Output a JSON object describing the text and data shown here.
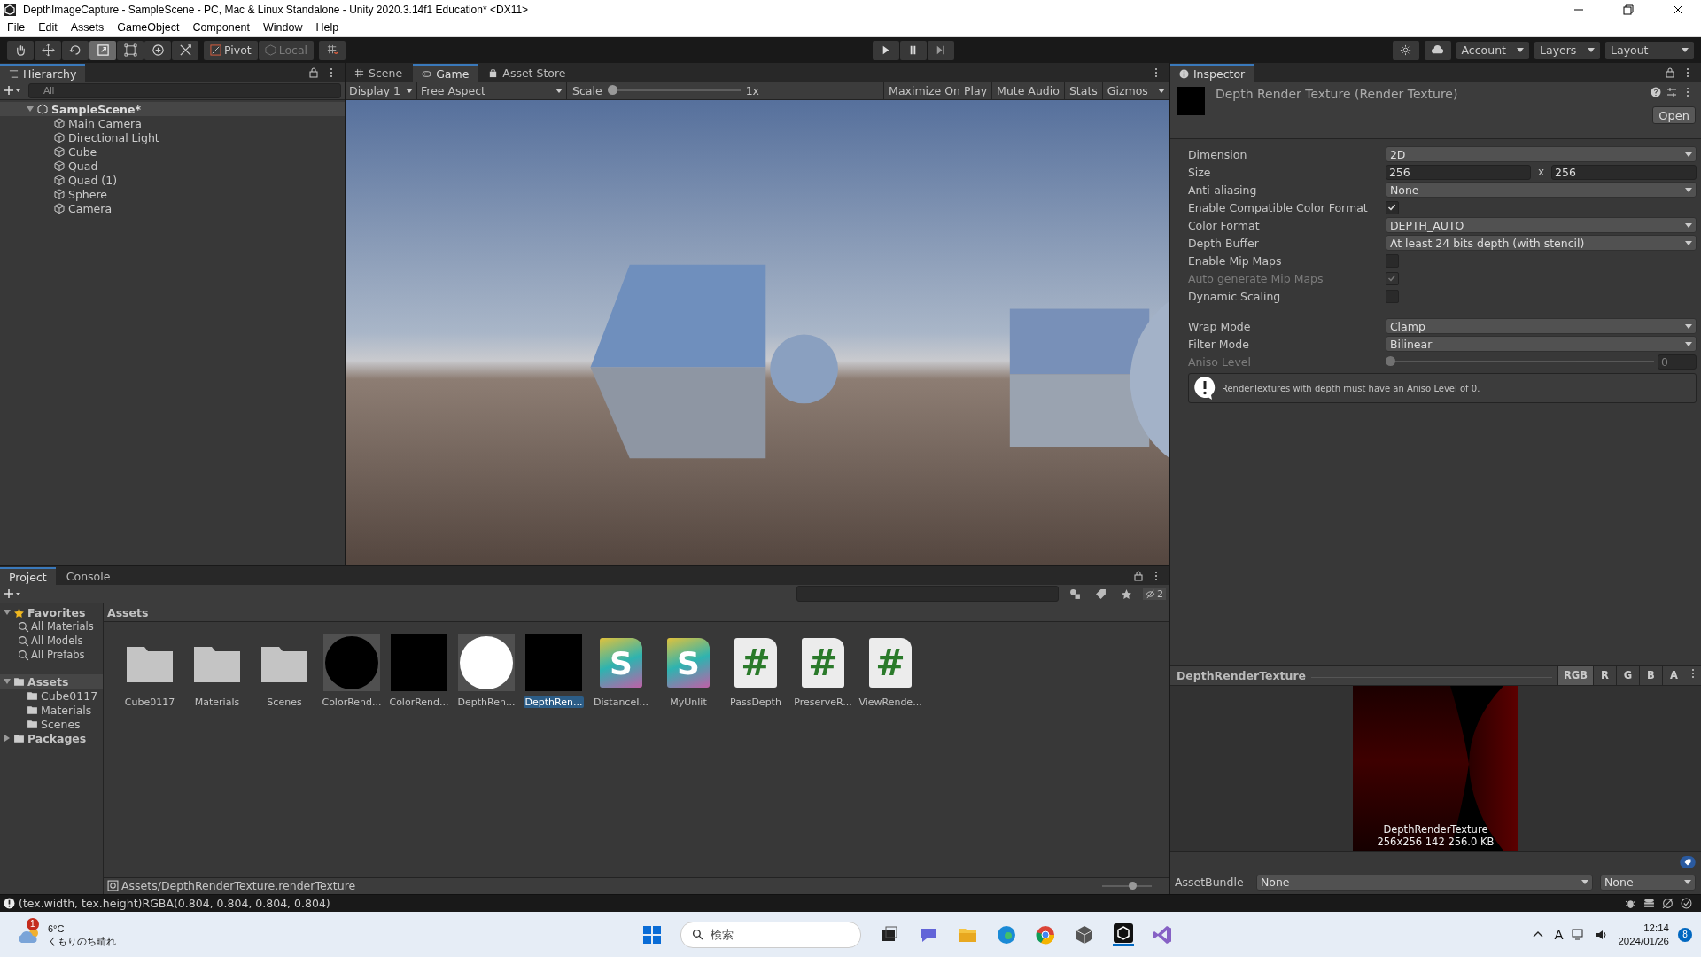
{
  "window": {
    "title": "DepthImageCapture - SampleScene - PC, Mac & Linux Standalone - Unity 2020.3.14f1 Education* <DX11>"
  },
  "menu": [
    "File",
    "Edit",
    "Assets",
    "GameObject",
    "Component",
    "Window",
    "Help"
  ],
  "toolbar": {
    "tools": [
      {
        "kind": "hand",
        "selected": false
      },
      {
        "kind": "move",
        "selected": false
      },
      {
        "kind": "rotate",
        "selected": false
      },
      {
        "kind": "scale",
        "selected": true
      },
      {
        "kind": "rect",
        "selected": false
      },
      {
        "kind": "transform",
        "selected": false
      },
      {
        "kind": "custom",
        "selected": false
      }
    ],
    "pivot": "Pivot",
    "local": "Local",
    "right": [
      "Account",
      "Layers",
      "Layout"
    ]
  },
  "hierarchy": {
    "title": "Hierarchy",
    "search_placeholder": "All",
    "scene": {
      "label": "SampleScene*",
      "expanded": true,
      "children": [
        {
          "label": "Main Camera"
        },
        {
          "label": "Directional Light"
        },
        {
          "label": "Cube"
        },
        {
          "label": "Quad"
        },
        {
          "label": "Quad (1)"
        },
        {
          "label": "Sphere"
        },
        {
          "label": "Camera"
        }
      ]
    }
  },
  "game": {
    "tabs": [
      {
        "label": "Scene",
        "kind": "scene",
        "selected": false
      },
      {
        "label": "Game",
        "kind": "game",
        "selected": true
      },
      {
        "label": "Asset Store",
        "kind": "store",
        "selected": false
      }
    ],
    "display": "Display 1",
    "aspect": "Free Aspect",
    "scale_label": "Scale",
    "scale": {
      "level": 0.0
    },
    "scale_value": "1x",
    "toggles": [
      "Maximize On Play",
      "Mute Audio",
      "Stats",
      "Gizmos"
    ]
  },
  "inspector": {
    "title": "Inspector",
    "asset": "Depth Render Texture (Render Texture)",
    "open": "Open",
    "props": [
      {
        "kind": "dropdown",
        "label": "Dimension",
        "value": "2D",
        "disabled": false
      },
      {
        "kind": "size",
        "label": "Size",
        "value": "256",
        "sep": "x",
        "value2": "256",
        "disabled": false
      },
      {
        "kind": "dropdown",
        "label": "Anti-aliasing",
        "value": "None",
        "disabled": false
      },
      {
        "kind": "checkbox",
        "label": "Enable Compatible Color Format",
        "checked": true,
        "disabled": false
      },
      {
        "kind": "dropdown",
        "label": "Color Format",
        "value": "DEPTH_AUTO",
        "disabled": false
      },
      {
        "kind": "dropdown",
        "label": "Depth Buffer",
        "value": "At least 24 bits depth (with stencil)",
        "disabled": false
      },
      {
        "kind": "checkbox",
        "label": "Enable Mip Maps",
        "checked": false,
        "disabled": false
      },
      {
        "kind": "checkbox",
        "label": "Auto generate Mip Maps",
        "checked": true,
        "disabled": true
      },
      {
        "kind": "checkbox",
        "label": "Dynamic Scaling",
        "checked": false,
        "disabled": false
      }
    ],
    "sampler_props": [
      {
        "kind": "dropdown",
        "label": "Wrap Mode",
        "value": "Clamp",
        "disabled": false
      },
      {
        "kind": "dropdown",
        "label": "Filter Mode",
        "value": "Bilinear",
        "disabled": false
      },
      {
        "kind": "slider",
        "label": "Aniso Level",
        "level": 0.0,
        "value": "0",
        "disabled": true
      }
    ],
    "help": "RenderTextures with depth must have an Aniso Level of 0."
  },
  "preview": {
    "title": "DepthRenderTexture",
    "channels": [
      {
        "label": "RGB",
        "selected": true
      },
      {
        "label": "R",
        "selected": false
      },
      {
        "label": "G",
        "selected": false
      },
      {
        "label": "B",
        "selected": false
      },
      {
        "label": "A",
        "selected": false
      }
    ],
    "caption": "DepthRenderTexture",
    "info": "256x256  142  256.0 KB"
  },
  "asset_bundle": {
    "label": "AssetBundle",
    "name": "None",
    "variant": "None"
  },
  "project": {
    "tabs": [
      {
        "label": "Project",
        "selected": true
      },
      {
        "label": "Console",
        "selected": false
      }
    ],
    "hidden_count": "2",
    "favorites": {
      "label": "Favorites",
      "expanded": true,
      "children": [
        {
          "label": "All Materials"
        },
        {
          "label": "All Models"
        },
        {
          "label": "All Prefabs"
        }
      ]
    },
    "assets": {
      "label": "Assets",
      "expanded": true,
      "children": [
        {
          "label": "Cube0117"
        },
        {
          "label": "Materials"
        },
        {
          "label": "Scenes"
        }
      ]
    },
    "packages": {
      "label": "Packages",
      "expanded": false
    },
    "breadcrumb": "Assets",
    "items": [
      {
        "kind": "folder",
        "label": "Cube0117",
        "selected": false
      },
      {
        "kind": "folder",
        "label": "Materials",
        "selected": false
      },
      {
        "kind": "folder",
        "label": "Scenes",
        "selected": false
      },
      {
        "kind": "round-texture",
        "label": "ColorRend...",
        "color": "#000000",
        "selected": false
      },
      {
        "kind": "texture",
        "label": "ColorRend...",
        "color": "#000000",
        "selected": false
      },
      {
        "kind": "round-texture",
        "label": "DepthRen...",
        "color": "#ffffff",
        "selected": false
      },
      {
        "kind": "texture",
        "label": "DepthRen...",
        "color": "#000000",
        "selected": true
      },
      {
        "kind": "shader",
        "label": "DistanceI...",
        "icon_text": "S",
        "selected": false
      },
      {
        "kind": "shader",
        "label": "MyUnlit",
        "icon_text": "S",
        "selected": false
      },
      {
        "kind": "script",
        "label": "PassDepth",
        "icon_text": "#",
        "selected": false
      },
      {
        "kind": "script",
        "label": "PreserveR...",
        "icon_text": "#",
        "selected": false
      },
      {
        "kind": "script",
        "label": "ViewRende...",
        "icon_text": "#",
        "selected": false
      }
    ],
    "path": "Assets/DepthRenderTexture.renderTexture",
    "zoom": {
      "level": 0.6
    }
  },
  "status": "(tex.width, tex.height)RGBA(0.804, 0.804, 0.804, 0.804)",
  "taskbar": {
    "weather_badge": "1",
    "temperature": "6°C",
    "weather": "くもりのち晴れ",
    "search": "検索",
    "time": "12:14",
    "date": "2024/01/26",
    "ime": "A",
    "notifications": "8"
  }
}
